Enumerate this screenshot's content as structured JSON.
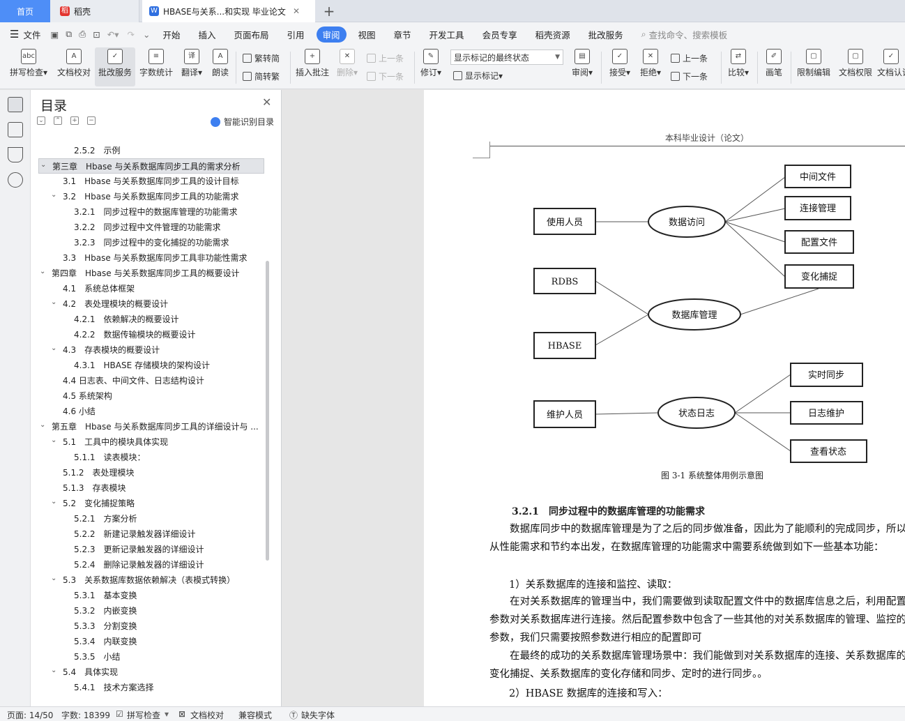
{
  "tabs": {
    "home": "首页",
    "daoke": "稻壳",
    "doc": "HBASE与关系...和实现 毕业论文",
    "plus": "+"
  },
  "menu": {
    "file": "文件",
    "items": [
      "开始",
      "插入",
      "页面布局",
      "引用",
      "审阅",
      "视图",
      "章节",
      "开发工具",
      "会员专享",
      "稻壳资源",
      "批改服务"
    ],
    "active": "审阅",
    "search_placeholder": "查找命令、搜索模板"
  },
  "ribbon": {
    "spell": "拼写检查",
    "proof": "文档校对",
    "review_service": "批改服务",
    "wordcount": "字数统计",
    "translate": "翻译",
    "read": "朗读",
    "trad": "繁转简",
    "simp": "简转繁",
    "insert_comment": "插入批注",
    "delete": "删除",
    "prev_comment": "上一条",
    "next_comment": "下一条",
    "revise": "修订",
    "markup_state": "显示标记的最终状态",
    "show_markup": "显示标记",
    "review": "审阅",
    "accept": "接受",
    "reject": "拒绝",
    "prev": "上一条",
    "next": "下一条",
    "compare": "比较",
    "pen": "画笔",
    "restrict": "限制编辑",
    "rights": "文档权限",
    "certify": "文档认证"
  },
  "toc": {
    "title": "目录",
    "smart": "智能识别目录",
    "rows": [
      {
        "text": "2.5.2　示例",
        "level": 3,
        "caret": ""
      },
      {
        "text": "第三章　Hbase 与关系数据库同步工具的需求分析",
        "level": 1,
        "caret": "v",
        "selected": true
      },
      {
        "text": "3.1　Hbase 与关系数据库同步工具的设计目标",
        "level": 2,
        "caret": ""
      },
      {
        "text": "3.2　Hbase 与关系数据库同步工具的功能需求",
        "level": 2,
        "caret": "v"
      },
      {
        "text": "3.2.1　同步过程中的数据库管理的功能需求",
        "level": 3,
        "caret": ""
      },
      {
        "text": "3.2.2　同步过程中文件管理的功能需求",
        "level": 3,
        "caret": ""
      },
      {
        "text": "3.2.3　同步过程中的变化捕捉的功能需求",
        "level": 3,
        "caret": ""
      },
      {
        "text": "3.3　Hbase 与关系数据库同步工具非功能性需求",
        "level": 2,
        "caret": ""
      },
      {
        "text": "第四章　Hbase 与关系数据库同步工具的概要设计",
        "level": 1,
        "caret": "v"
      },
      {
        "text": "4.1　系统总体框架",
        "level": 2,
        "caret": ""
      },
      {
        "text": "4.2　表处理模块的概要设计",
        "level": 2,
        "caret": "v"
      },
      {
        "text": "4.2.1　依赖解决的概要设计",
        "level": 3,
        "caret": ""
      },
      {
        "text": "4.2.2　数据传输模块的概要设计",
        "level": 3,
        "caret": ""
      },
      {
        "text": "4.3　存表模块的概要设计",
        "level": 2,
        "caret": "v"
      },
      {
        "text": "4.3.1　HBASE 存储模块的架构设计",
        "level": 3,
        "caret": ""
      },
      {
        "text": "4.4 日志表、中间文件、日志结构设计",
        "level": 2,
        "caret": ""
      },
      {
        "text": "4.5 系统架构",
        "level": 2,
        "caret": ""
      },
      {
        "text": "4.6 小结",
        "level": 2,
        "caret": ""
      },
      {
        "text": "第五章　Hbase 与关系数据库同步工具的详细设计与 ...",
        "level": 1,
        "caret": "v"
      },
      {
        "text": "5.1　工具中的模块具体实现",
        "level": 2,
        "caret": "v"
      },
      {
        "text": "5.1.1　读表模块：",
        "level": 3,
        "caret": ""
      },
      {
        "text": "5.1.2　表处理模块",
        "level": 2,
        "caret": ""
      },
      {
        "text": "5.1.3　存表模块",
        "level": 2,
        "caret": ""
      },
      {
        "text": "5.2　变化捕捉策略",
        "level": 2,
        "caret": "v"
      },
      {
        "text": "5.2.1　方案分析",
        "level": 3,
        "caret": ""
      },
      {
        "text": "5.2.2　新建记录触发器详细设计",
        "level": 3,
        "caret": ""
      },
      {
        "text": "5.2.3　更新记录触发器的详细设计",
        "level": 3,
        "caret": ""
      },
      {
        "text": "5.2.4　删除记录触发器的详细设计",
        "level": 3,
        "caret": ""
      },
      {
        "text": "5.3　关系数据库数据依赖解决（表模式转换）",
        "level": 2,
        "caret": "v"
      },
      {
        "text": "5.3.1　基本变换",
        "level": 3,
        "caret": ""
      },
      {
        "text": "5.3.2　内嵌变换",
        "level": 3,
        "caret": ""
      },
      {
        "text": "5.3.3　分割变换",
        "level": 3,
        "caret": ""
      },
      {
        "text": "5.3.4　内联变换",
        "level": 3,
        "caret": ""
      },
      {
        "text": "5.3.5　小结",
        "level": 3,
        "caret": ""
      },
      {
        "text": "5.4　具体实现",
        "level": 2,
        "caret": "v"
      },
      {
        "text": "5.4.1　技术方案选择",
        "level": 3,
        "caret": ""
      }
    ]
  },
  "page": {
    "header": "本科毕业设计（论文）",
    "diagram": {
      "actors": [
        "使用人员",
        "RDBS",
        "HBASE",
        "维护人员"
      ],
      "usecases": [
        "数据访问",
        "数据库管理",
        "状态日志"
      ],
      "outputs": [
        "中间文件",
        "连接管理",
        "配置文件",
        "变化捕捉",
        "实时同步",
        "日志维护",
        "查看状态"
      ]
    },
    "caption": "图 3-1 系统整体用例示意图",
    "section": "3.2.1　同步过程中的数据库管理的功能需求",
    "p1": "数据库同步中的数据库管理是为了之后的同步做准备，因此为了能顺利的完成同步，所以从性能需求和节约本出发，在数据库管理的功能需求中需要系统做到如下一些基本功能：",
    "item1": "1）关系数据库的连接和监控、读取：",
    "p2": "在对关系数据库的管理当中，我们需要做到读取配置文件中的数据库信息之后，利用配置参数对关系数据库进行连接。然后配置参数中包含了一些其他的对关系数据库的管理、监控的参数，我们只需要按照参数进行相应的配置即可",
    "p3": "在最终的成功的关系数据库管理场景中：我们能做到对关系数据库的连接、关系数据库的变化捕捉、关系数据库的变化存储和同步、定时的进行同步。。",
    "item2": "2）HBASE 数据库的连接和写入："
  },
  "status": {
    "page": "页面: 14/50",
    "words": "字数: 18399",
    "spell": "拼写检查",
    "proof": "文档校对",
    "compat": "兼容模式",
    "missing_font": "缺失字体"
  }
}
